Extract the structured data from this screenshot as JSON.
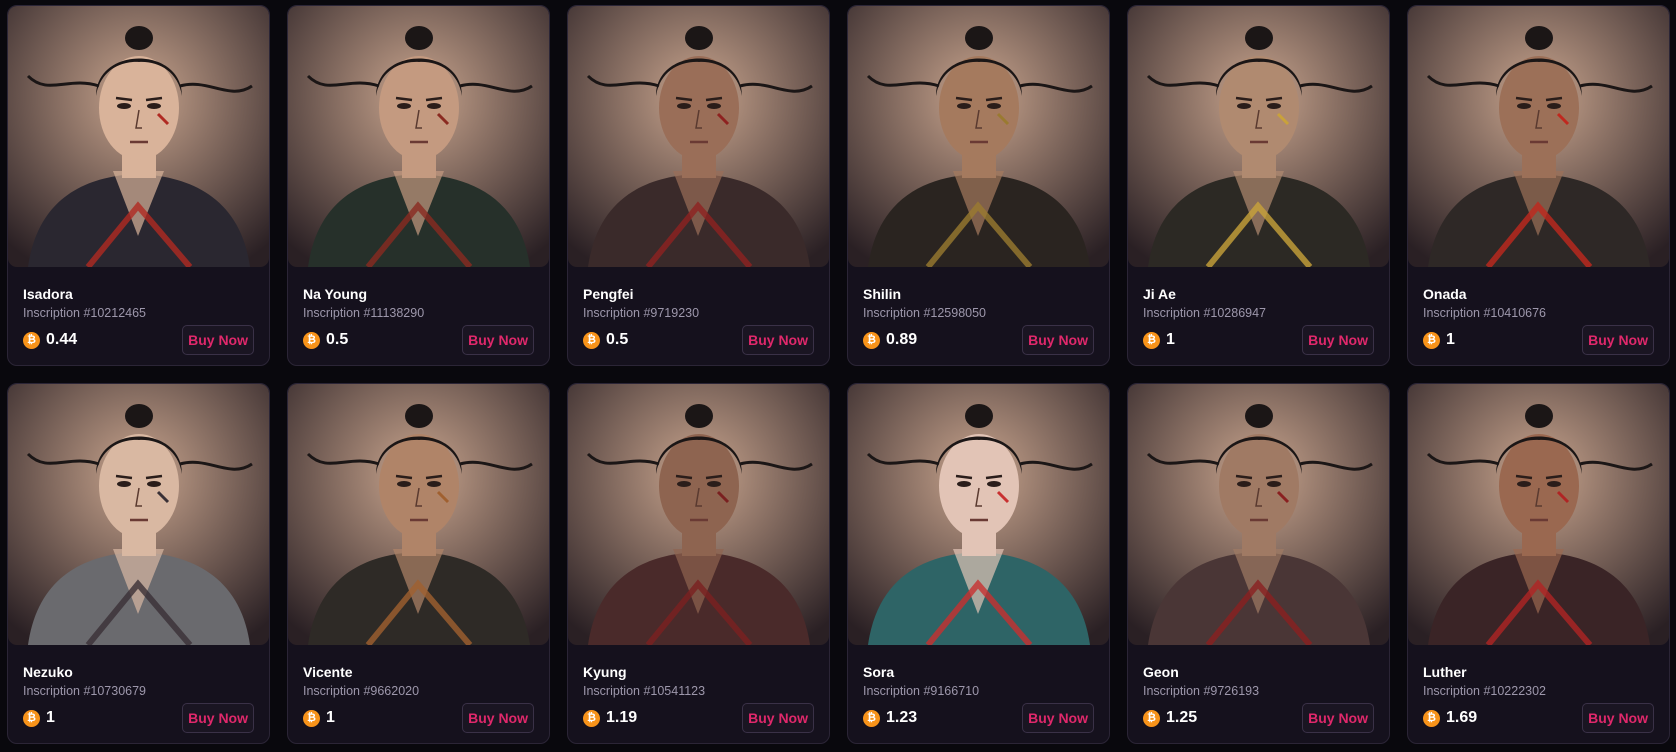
{
  "cards": [
    {
      "name": "Isadora",
      "inscription": "Inscription #10212465",
      "price": "0.44",
      "buy_label": "Buy Now",
      "bg": "#c9a58e",
      "skin": "#d9b39a",
      "robe": "#2a2730",
      "accent": "#b02a22"
    },
    {
      "name": "Na Young",
      "inscription": "Inscription #11138290",
      "price": "0.5",
      "buy_label": "Buy Now",
      "bg": "#a89278",
      "skin": "#c49a80",
      "robe": "#26302a",
      "accent": "#8a2a20"
    },
    {
      "name": "Pengfei",
      "inscription": "Inscription #9719230",
      "price": "0.5",
      "buy_label": "Buy Now",
      "bg": "#b8937a",
      "skin": "#9a6e58",
      "robe": "#3a2a2a",
      "accent": "#8e2220"
    },
    {
      "name": "Shilin",
      "inscription": "Inscription #12598050",
      "price": "0.89",
      "buy_label": "Buy Now",
      "bg": "#c6a48c",
      "skin": "#a57a5e",
      "robe": "#2a2420",
      "accent": "#9a7a30"
    },
    {
      "name": "Ji Ae",
      "inscription": "Inscription #10286947",
      "price": "1",
      "buy_label": "Buy Now",
      "bg": "#b3a494",
      "skin": "#b08a70",
      "robe": "#2c2924",
      "accent": "#c9a23a"
    },
    {
      "name": "Onada",
      "inscription": "Inscription #10410676",
      "price": "1",
      "buy_label": "Buy Now",
      "bg": "#cdbfae",
      "skin": "#9c7058",
      "robe": "#2e2826",
      "accent": "#c0281e"
    },
    {
      "name": "Nezuko",
      "inscription": "Inscription #10730679",
      "price": "1",
      "buy_label": "Buy Now",
      "bg": "#c8b2a2",
      "skin": "#d9b8a2",
      "robe": "#6a6a6e",
      "accent": "#3a3036"
    },
    {
      "name": "Vicente",
      "inscription": "Inscription #9662020",
      "price": "1",
      "buy_label": "Buy Now",
      "bg": "#b89276",
      "skin": "#b08468",
      "robe": "#2e2a26",
      "accent": "#a06030"
    },
    {
      "name": "Kyung",
      "inscription": "Inscription #10541123",
      "price": "1.19",
      "buy_label": "Buy Now",
      "bg": "#c0988a",
      "skin": "#8e6450",
      "robe": "#4a2a2a",
      "accent": "#7a2020"
    },
    {
      "name": "Sora",
      "inscription": "Inscription #9166710",
      "price": "1.23",
      "buy_label": "Buy Now",
      "bg": "#c8a896",
      "skin": "#e2c4b6",
      "robe": "#2e6466",
      "accent": "#c83030"
    },
    {
      "name": "Geon",
      "inscription": "Inscription #9726193",
      "price": "1.25",
      "buy_label": "Buy Now",
      "bg": "#c4aa96",
      "skin": "#a07a64",
      "robe": "#4a3636",
      "accent": "#8a2020"
    },
    {
      "name": "Luther",
      "inscription": "Inscription #10222302",
      "price": "1.69",
      "buy_label": "Buy Now",
      "bg": "#c89a80",
      "skin": "#9a6850",
      "robe": "#3a2426",
      "accent": "#b02424"
    }
  ],
  "currency_icon": "bitcoin-icon",
  "currency_symbol": "₿",
  "colors": {
    "page_bg": "#09080d",
    "card_bg": "#15111d",
    "buy_text": "#e0286b",
    "btc": "#f7931a"
  }
}
